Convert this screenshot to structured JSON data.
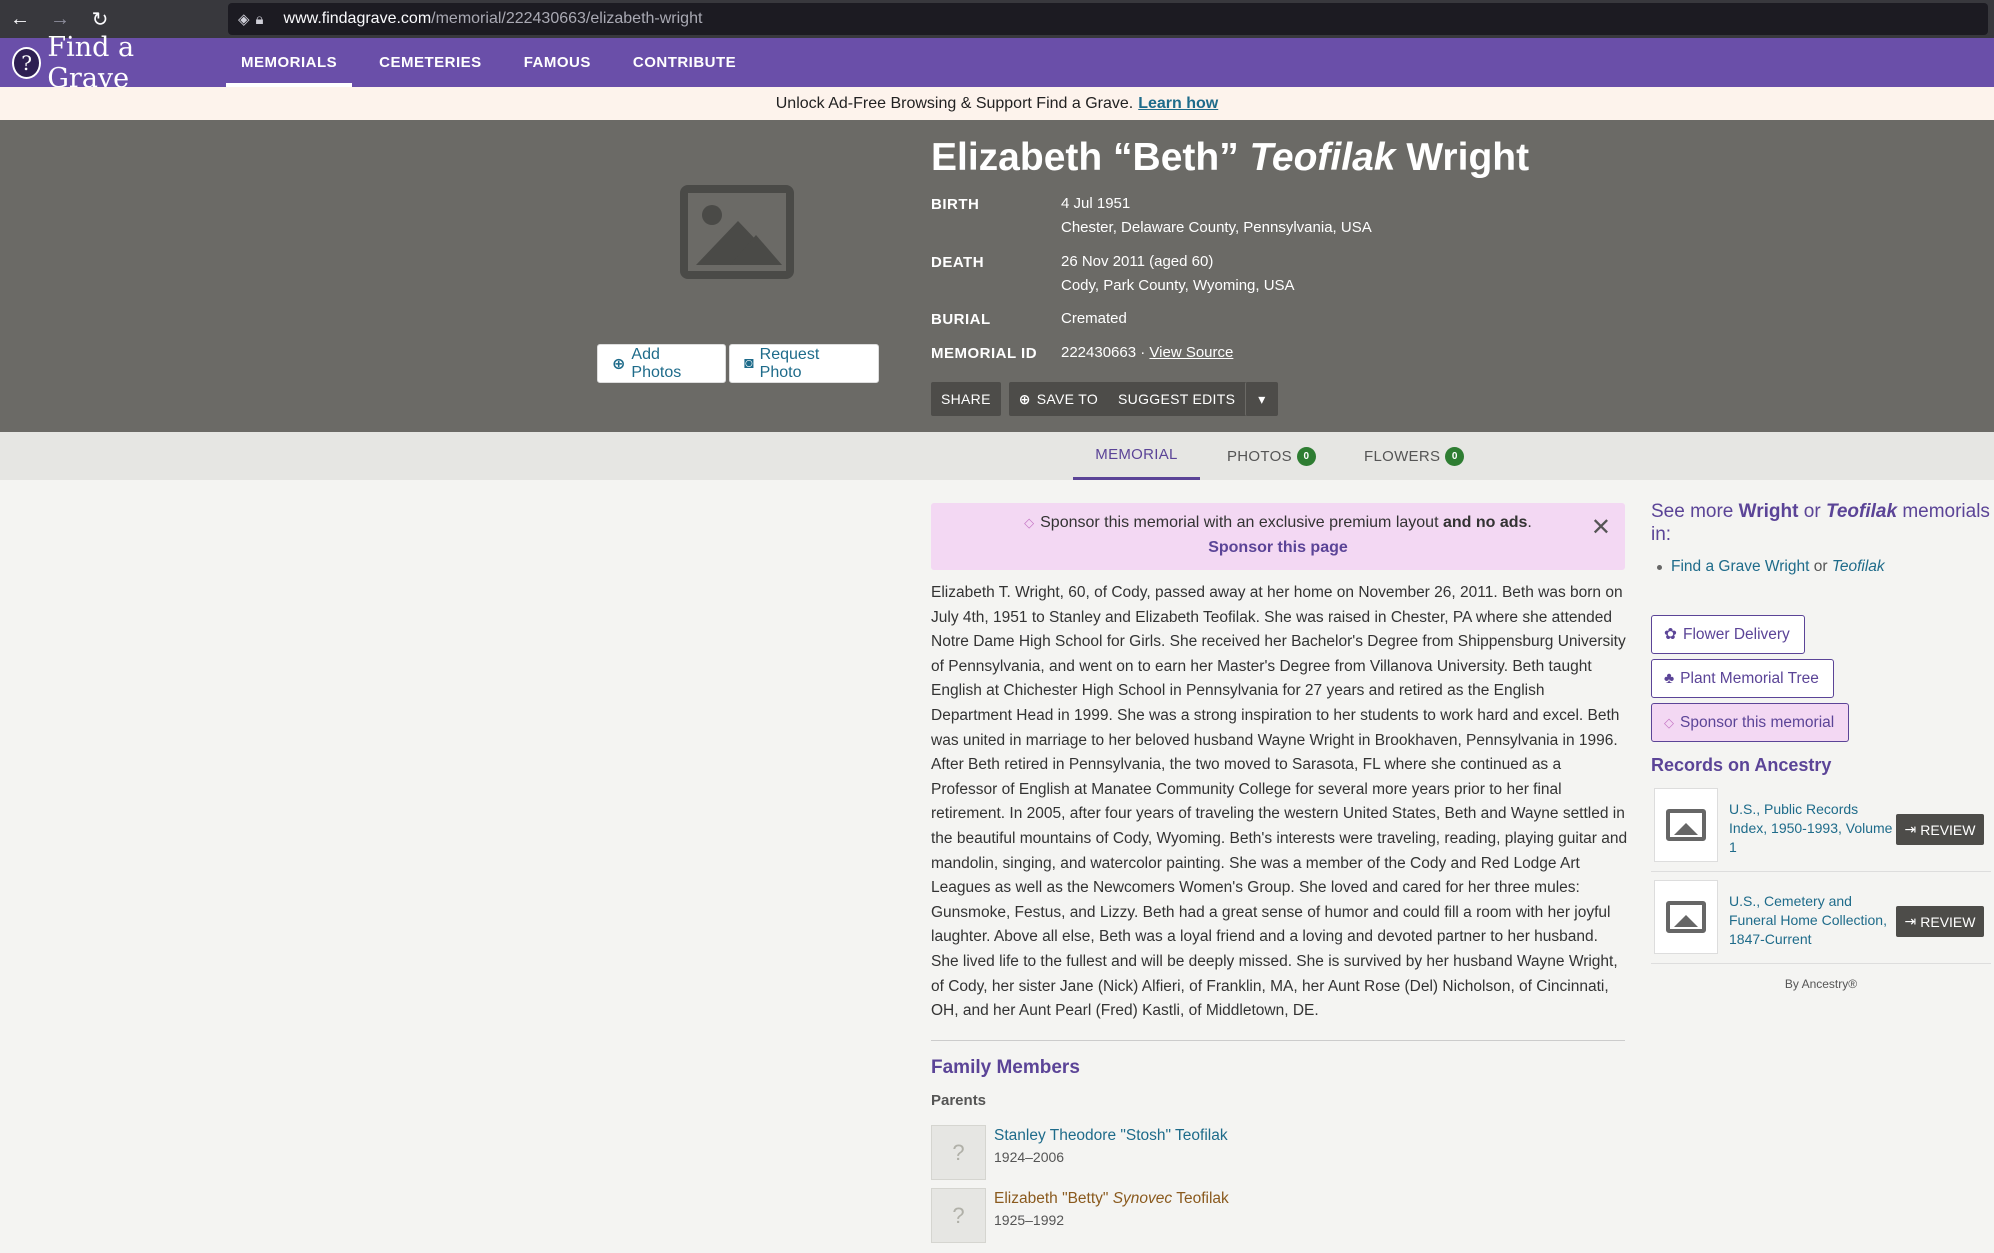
{
  "browser": {
    "url_domain": "www.findagrave.com",
    "url_path": "/memorial/222430663/elizabeth-wright"
  },
  "site": {
    "logo_text": "Find a Grave",
    "nav": [
      "MEMORIALS",
      "CEMETERIES",
      "FAMOUS",
      "CONTRIBUTE"
    ]
  },
  "promo": {
    "text": "Unlock Ad-Free Browsing & Support Find a Grave.",
    "link": "Learn how"
  },
  "hero": {
    "add_photos": "Add Photos",
    "request_photo": "Request Photo",
    "name_first": "Elizabeth “Beth”",
    "name_maiden": "Teofilak",
    "name_last": "Wright",
    "birth_label": "BIRTH",
    "birth_date": "4 Jul 1951",
    "birth_place": "Chester, Delaware County, Pennsylvania, USA",
    "death_label": "DEATH",
    "death_date": "26 Nov 2011 (aged 60)",
    "death_place": "Cody, Park County, Wyoming, USA",
    "burial_label": "BURIAL",
    "burial_value": "Cremated",
    "memorial_id_label": "MEMORIAL ID",
    "memorial_id": "222430663 ·",
    "view_source": "View Source",
    "share": "SHARE",
    "save_to": "SAVE TO",
    "suggest_edits": "SUGGEST EDITS"
  },
  "tabs": {
    "memorial": "MEMORIAL",
    "photos": "PHOTOS",
    "photos_count": "0",
    "flowers": "FLOWERS",
    "flowers_count": "0"
  },
  "sponsor": {
    "text": "Sponsor this memorial with an exclusive premium layout",
    "bold": "and no ads",
    "period": ".",
    "link": "Sponsor this page"
  },
  "bio": "Elizabeth T. Wright, 60, of Cody, passed away at her home on November 26, 2011. Beth was born on July 4th, 1951 to Stanley and Elizabeth Teofilak. She was raised in Chester, PA where she attended Notre Dame High School for Girls. She received her Bachelor's Degree from Shippensburg University of Pennsylvania, and went on to earn her Master's Degree from Villanova University. Beth taught English at Chichester High School in Pennsylvania for 27 years and retired as the English Department Head in 1999. She was a strong inspiration to her students to work hard and excel. Beth was united in marriage to her beloved husband Wayne Wright in Brookhaven, Pennsylvania in 1996. After Beth retired in Pennsylvania, the two moved to Sarasota, FL where she continued as a Professor of English at Manatee Community College for several more years prior to her final retirement. In 2005, after four years of traveling the western United States, Beth and Wayne settled in the beautiful mountains of Cody, Wyoming. Beth's interests were traveling, reading, playing guitar and mandolin, singing, and watercolor painting. She was a member of the Cody and Red Lodge Art Leagues as well as the Newcomers Women's Group. She loved and cared for her three mules: Gunsmoke, Festus, and Lizzy. Beth had a great sense of humor and could fill a room with her joyful laughter. Above all else, Beth was a loyal friend and a loving and devoted partner to her husband. She lived life to the fullest and will be deeply missed. She is survived by her husband Wayne Wright, of Cody, her sister Jane (Nick) Alfieri, of Franklin, MA, her Aunt Rose (Del) Nicholson, of Cincinnati, OH, and her Aunt Pearl (Fred) Kastli, of Middletown, DE.",
  "family": {
    "title": "Family Members",
    "parents_label": "Parents",
    "father_name": "Stanley Theodore \"Stosh\" Teofilak",
    "father_dates": "1924–2006",
    "mother_first": "Elizabeth \"Betty\"",
    "mother_maiden": "Synovec",
    "mother_last": "Teofilak",
    "mother_dates": "1925–1992"
  },
  "sidebar": {
    "see_more_pre": "See more",
    "see_more_name1": "Wright",
    "see_more_or": "or",
    "see_more_name2": "Teofilak",
    "see_more_post": "memorials in:",
    "link_pre": "Find a Grave Wright",
    "link_or": "or",
    "link_name": "Teofilak",
    "flower_delivery": "Flower Delivery",
    "plant_tree": "Plant Memorial Tree",
    "sponsor_memorial": "Sponsor this memorial",
    "records_title": "Records on Ancestry",
    "record1": "U.S., Public Records Index, 1950-1993, Volume 1",
    "record2": "U.S., Cemetery and Funeral Home Collection, 1847-Current",
    "review": "REVIEW",
    "by_ancestry": "By Ancestry®"
  },
  "colors": {
    "brand_purple": "#6a4fa9",
    "hero_gray": "#6b6a66",
    "link_blue": "#1e6b8a",
    "badge_green": "#2e7d32",
    "sponsor_pink": "#f3d8f3"
  }
}
